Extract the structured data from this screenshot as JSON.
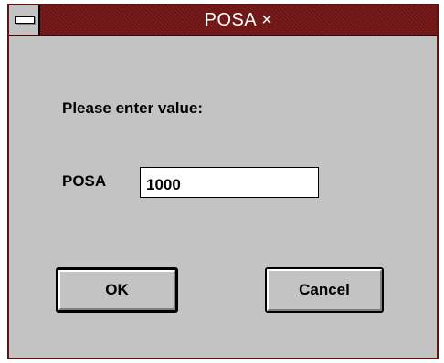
{
  "dialog": {
    "title": "POSA ×",
    "prompt": "Please enter value:",
    "field_label": "POSA",
    "field_value": "1000",
    "ok": {
      "mnemonic": "O",
      "rest": "K"
    },
    "cancel": {
      "mnemonic": "C",
      "rest": "ancel"
    }
  },
  "colors": {
    "titlebar": "#6e1414",
    "window_face": "#c3c3c3",
    "title_text": "#ffffff"
  },
  "icons": {
    "system_menu": "system-menu-icon"
  }
}
